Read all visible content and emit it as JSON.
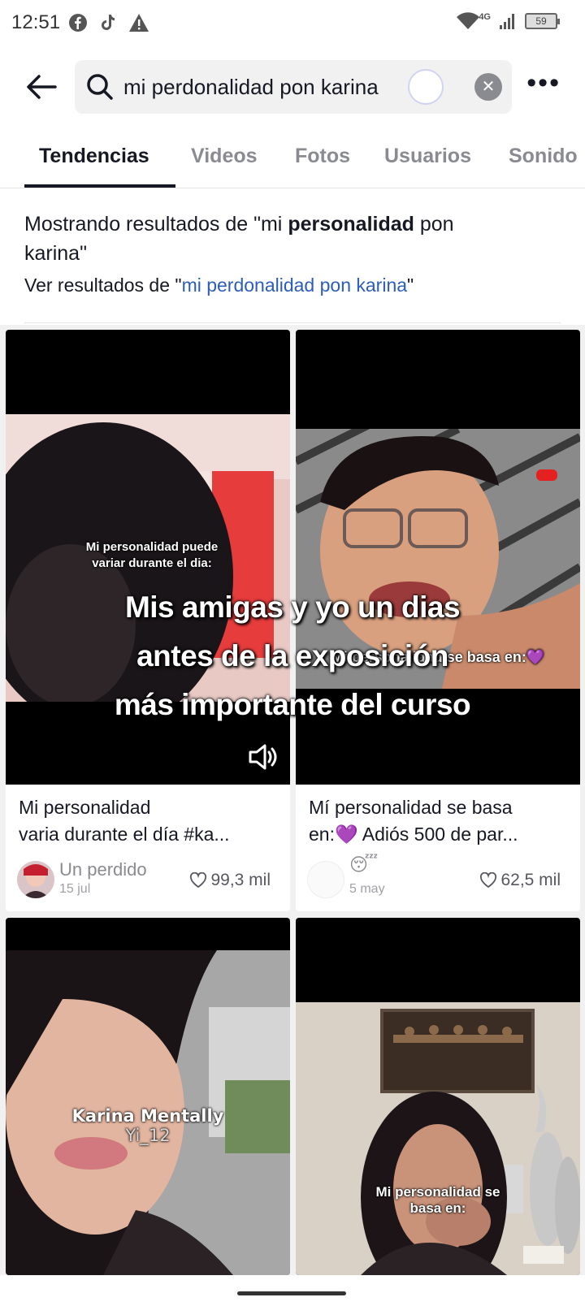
{
  "status_bar": {
    "time": "12:51",
    "network": "4G",
    "battery": "59",
    "icons_left": [
      "facebook-icon",
      "tiktok-icon",
      "warning-icon"
    ]
  },
  "search": {
    "query": "mi perdonalidad pon karina"
  },
  "tabs": [
    {
      "label": "Tendencias",
      "active": true
    },
    {
      "label": "Videos",
      "active": false
    },
    {
      "label": "Fotos",
      "active": false
    },
    {
      "label": "Usuarios",
      "active": false
    },
    {
      "label": "Sonido",
      "active": false
    }
  ],
  "correction": {
    "prefix": "Mostrando resultados de \"mi ",
    "bold_word": "personalidad",
    "suffix_word": " pon",
    "line_end": "karina\"",
    "alt_prefix": "Ver resultados de \"",
    "alt_query": "mi perdonalidad pon karina",
    "alt_suffix": "\""
  },
  "overlay": {
    "line1": "Mis amigas y yo un dias",
    "line2": "antes de la exposición",
    "line3": "más importante del curso"
  },
  "cards": [
    {
      "thumb_caption_l1": "Mi personalidad puede",
      "thumb_caption_l2": "variar durante el dia:",
      "title_l1": "Mi personalidad",
      "title_l2": "varia durante el día #ka...",
      "author": "Un perdido",
      "date": "15 jul",
      "likes": "99,3 mil"
    },
    {
      "thumb_caption": "Mi personalidad se basa en:💜",
      "title_l1": "Mí personalidad se basa",
      "title_l2": "en:💜 Adiós 500 de par...",
      "author_emoji": "😴",
      "date": "5 may",
      "likes": "62,5 mil"
    },
    {
      "thumb_caption_l1": "Karina Mentally",
      "thumb_caption_l2": "Yi_12"
    },
    {
      "thumb_caption_l1": "Mi personalidad se",
      "thumb_caption_l2": "basa en:"
    }
  ],
  "colors": {
    "text": "#161823",
    "muted": "#8a8b91",
    "link": "#2b5db9",
    "tab_active": "#161823",
    "grid_bg": "#f1f1f2"
  }
}
